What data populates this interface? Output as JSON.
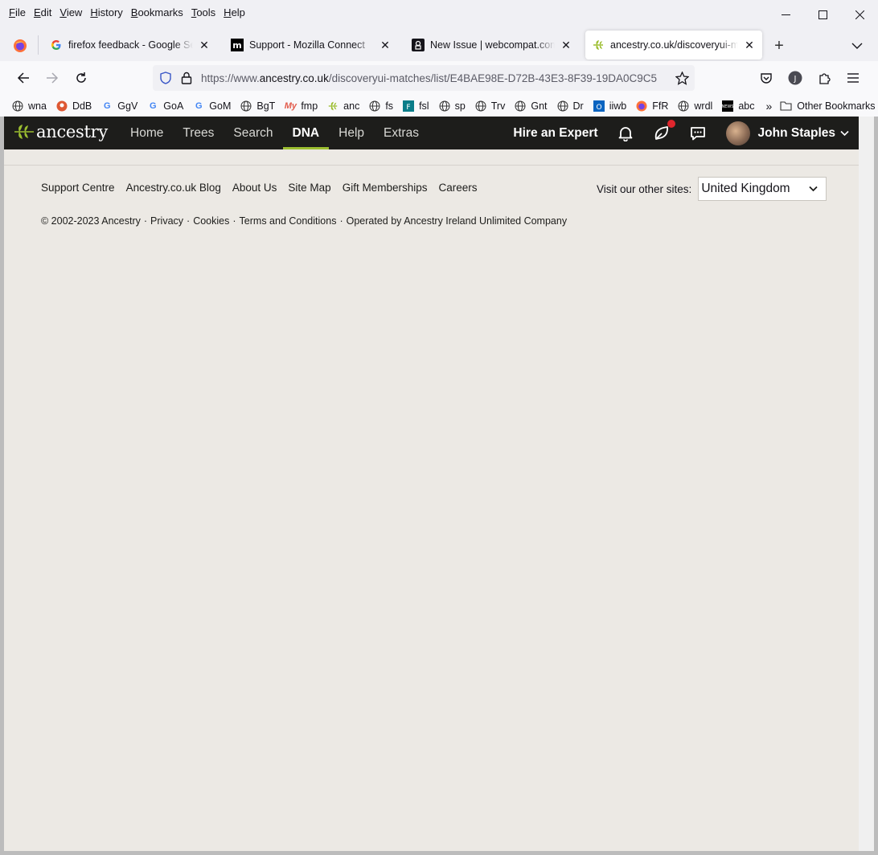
{
  "menubar": {
    "items": [
      {
        "label": "File",
        "key": "F",
        "rest": "ile"
      },
      {
        "label": "Edit",
        "key": "E",
        "rest": "dit"
      },
      {
        "label": "View",
        "key": "V",
        "rest": "iew"
      },
      {
        "label": "History",
        "key": "H",
        "rest": "istory"
      },
      {
        "label": "Bookmarks",
        "key": "B",
        "rest": "ookmarks"
      },
      {
        "label": "Tools",
        "key": "T",
        "rest": "ools"
      },
      {
        "label": "Help",
        "key": "H",
        "rest": "elp"
      }
    ]
  },
  "tabs": [
    {
      "title": "firefox feedback - Google Search",
      "icon": "google-icon"
    },
    {
      "title": "Support - Mozilla Connect",
      "icon": "mozilla-icon"
    },
    {
      "title": "New Issue | webcompat.com",
      "icon": "webcompat-icon"
    },
    {
      "title": "ancestry.co.uk/discoveryui-matches",
      "icon": "ancestry-leaf-icon",
      "active": true
    }
  ],
  "url": {
    "scheme": "https://www.",
    "host": "ancestry.co.uk",
    "path": "/discoveryui-matches/list/E4BAE98E-D72B-43E3-8F39-19DA0C9C5"
  },
  "bookmarks": {
    "items": [
      "wna",
      "DdB",
      "GgV",
      "GoA",
      "GoM",
      "BgT",
      "fmp",
      "anc",
      "fs",
      "fsl",
      "sp",
      "Trv",
      "Gnt",
      "Dr",
      "iiwb",
      "FfR",
      "wrdl",
      "abc"
    ],
    "other": "Other Bookmarks"
  },
  "ancestry": {
    "logo_text": "ancestry",
    "nav": [
      "Home",
      "Trees",
      "Search",
      "DNA",
      "Help",
      "Extras"
    ],
    "active_nav": "DNA",
    "hire": "Hire an Expert",
    "user_name": "John Staples"
  },
  "footer": {
    "links": [
      "Support Centre",
      "Ancestry.co.uk Blog",
      "About Us",
      "Site Map",
      "Gift Memberships",
      "Careers"
    ],
    "other_sites_label": "Visit our other sites:",
    "other_sites_value": "United Kingdom",
    "copyright": "© 2002-2023 Ancestry",
    "legal": [
      "Privacy",
      "Cookies",
      "Terms and Conditions",
      "Operated by Ancestry Ireland Unlimited Company"
    ]
  },
  "colors": {
    "accent_green": "#9cbe30",
    "header_bg": "#1d1d1b",
    "page_bg": "#ece9e4",
    "badge_red": "#e0262d"
  }
}
